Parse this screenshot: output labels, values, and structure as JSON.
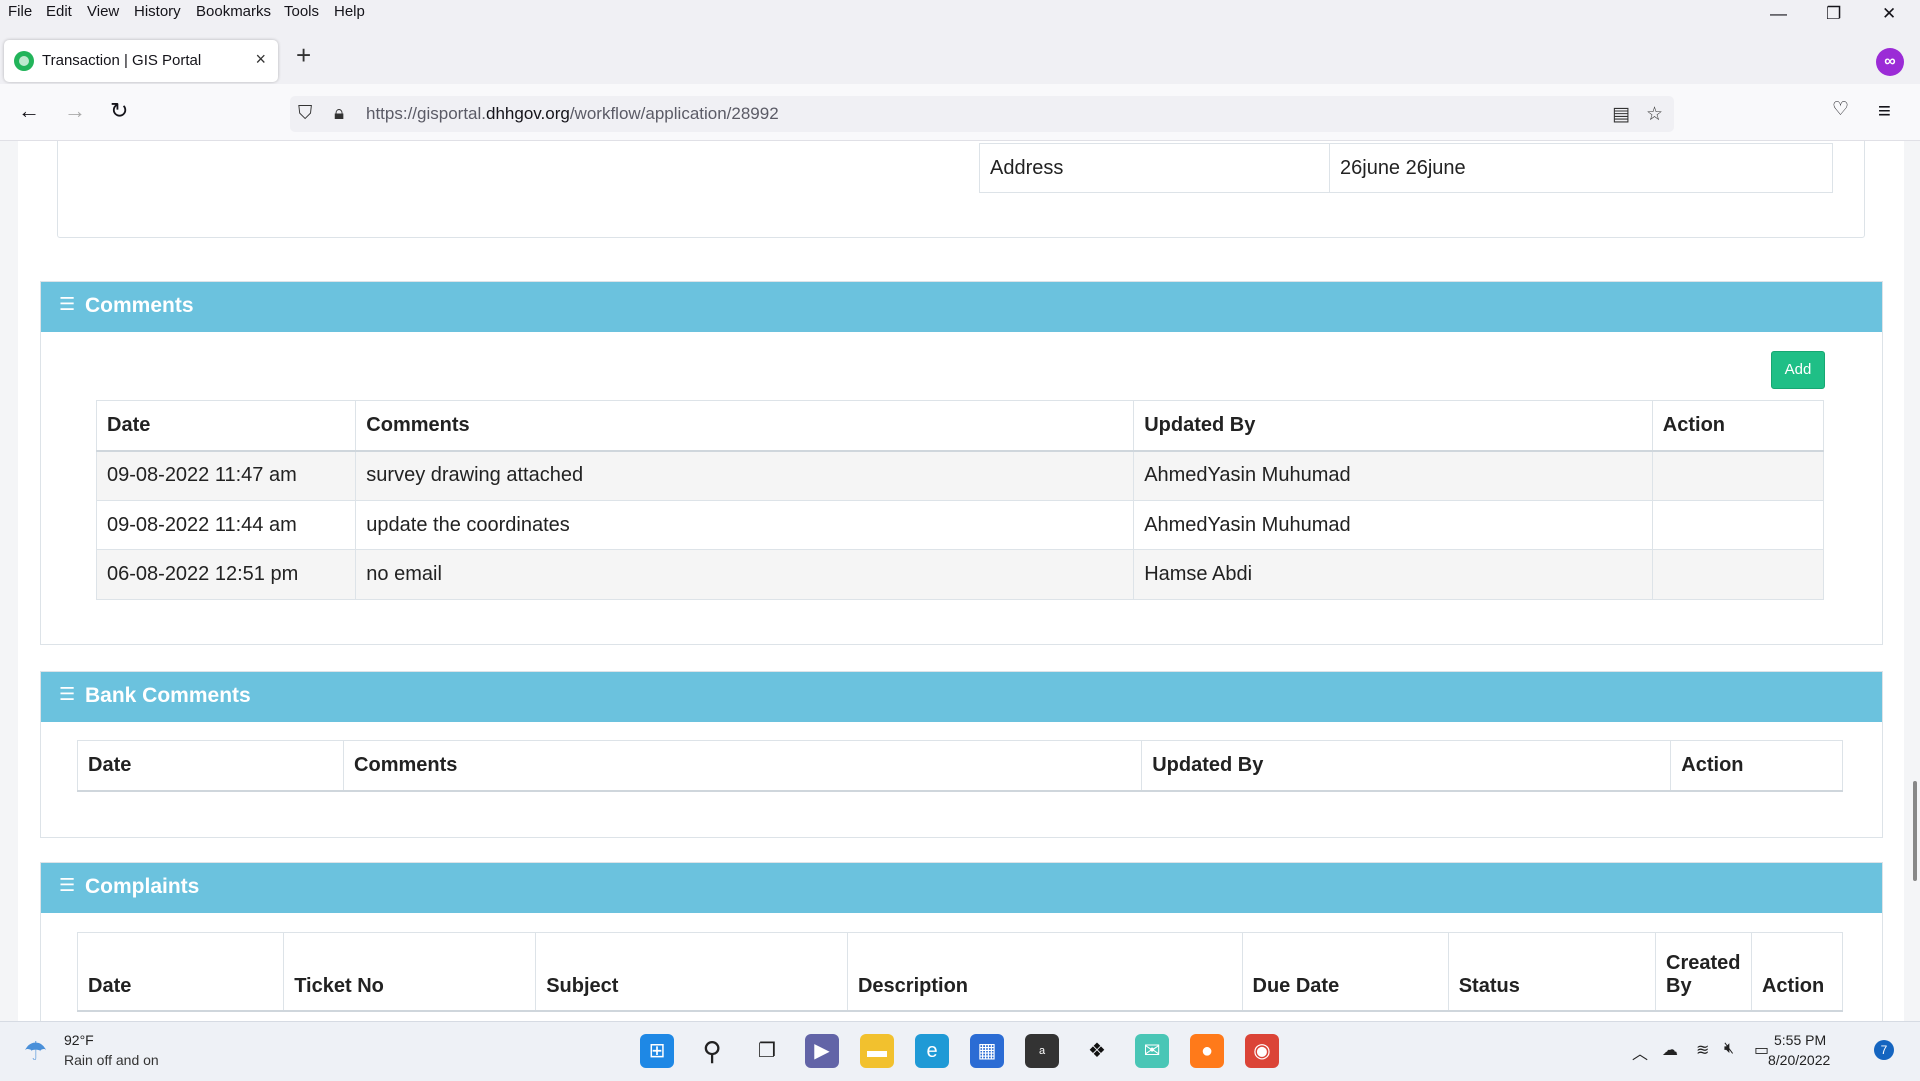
{
  "menubar": {
    "items": [
      "File",
      "Edit",
      "View",
      "History",
      "Bookmarks",
      "Tools",
      "Help"
    ]
  },
  "window_controls": {
    "minimize": "—",
    "restore": "❐",
    "close": "✕"
  },
  "tab": {
    "title": "Transaction | GIS Portal",
    "close": "×"
  },
  "newtab": "+",
  "url": {
    "prefix": "https://gisportal.",
    "domain": "dhhgov.org",
    "path": "/workflow/application/28992"
  },
  "address_row": {
    "label": "Address",
    "value": "26june 26june"
  },
  "comments_panel": {
    "title": "Comments",
    "add_label": "Add",
    "columns": [
      "Date",
      "Comments",
      "Updated By",
      "Action"
    ],
    "rows": [
      {
        "date": "09-08-2022 11:47 am",
        "comment": "survey drawing attached",
        "updated_by": "AhmedYasin Muhumad",
        "action": ""
      },
      {
        "date": "09-08-2022 11:44 am",
        "comment": "update the coordinates",
        "updated_by": "AhmedYasin Muhumad",
        "action": ""
      },
      {
        "date": "06-08-2022 12:51 pm",
        "comment": "no email",
        "updated_by": "Hamse Abdi",
        "action": ""
      }
    ]
  },
  "bank_comments_panel": {
    "title": "Bank Comments",
    "columns": [
      "Date",
      "Comments",
      "Updated By",
      "Action"
    ]
  },
  "complaints_panel": {
    "title": "Complaints",
    "columns": [
      "Date",
      "Ticket No",
      "Subject",
      "Description",
      "Due Date",
      "Status",
      "Created By",
      "Action"
    ]
  },
  "taskbar": {
    "weather_temp": "92°F",
    "weather_desc": "Rain off and on",
    "time": "5:55 PM",
    "date": "8/20/2022",
    "notifications": "7"
  },
  "colors": {
    "panel_header": "#6bc2de",
    "add_button": "#1fbf86"
  }
}
